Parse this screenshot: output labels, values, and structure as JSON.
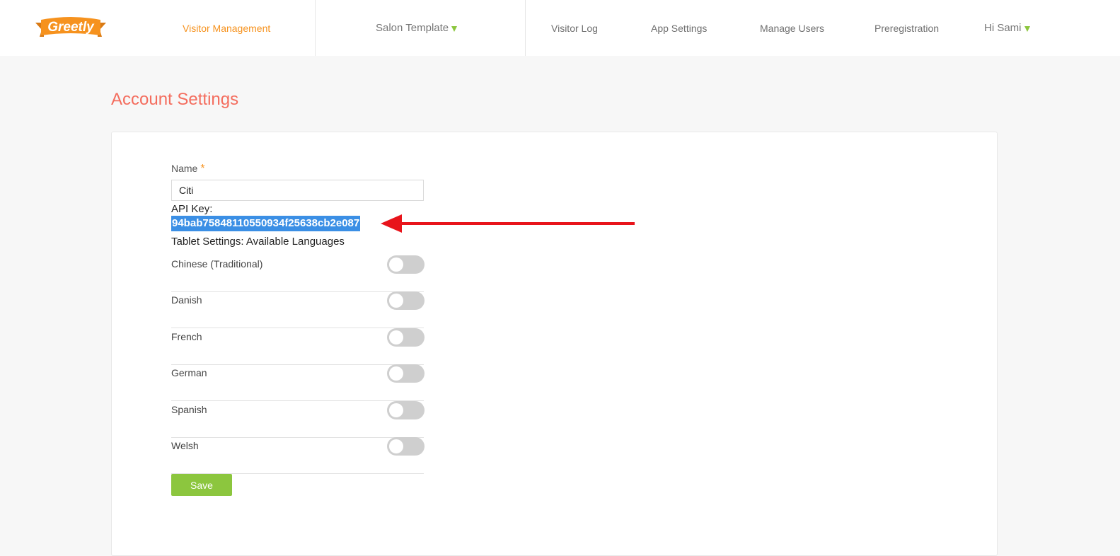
{
  "header": {
    "logo_text": "Greetly",
    "nav": {
      "visitor_management": "Visitor Management",
      "salon_template": "Salon Template",
      "visitor_log": "Visitor Log",
      "app_settings": "App Settings",
      "manage_users": "Manage Users",
      "preregistration": "Preregistration",
      "user_greeting": "Hi Sami"
    },
    "active_item": "Visitor Management"
  },
  "page": {
    "title": "Account Settings"
  },
  "form": {
    "name_label": "Name",
    "required_marker": "*",
    "name_value": "Citi",
    "api_key_label": "API Key:",
    "api_key_value": "94bab75848110550934f25638cb2e087",
    "tablet_settings_title": "Tablet Settings: Available Languages",
    "languages": [
      {
        "label": "Chinese (Traditional)",
        "enabled": false
      },
      {
        "label": "Danish",
        "enabled": false
      },
      {
        "label": "French",
        "enabled": false
      },
      {
        "label": "German",
        "enabled": false
      },
      {
        "label": "Spanish",
        "enabled": false
      },
      {
        "label": "Welsh",
        "enabled": false
      }
    ],
    "save_label": "Save"
  },
  "colors": {
    "brand_orange": "#f6921e",
    "title_coral": "#f46d5e",
    "accent_green": "#8cc63e",
    "selection_blue": "#3b8fe5",
    "annotation_red": "#e8141b"
  }
}
